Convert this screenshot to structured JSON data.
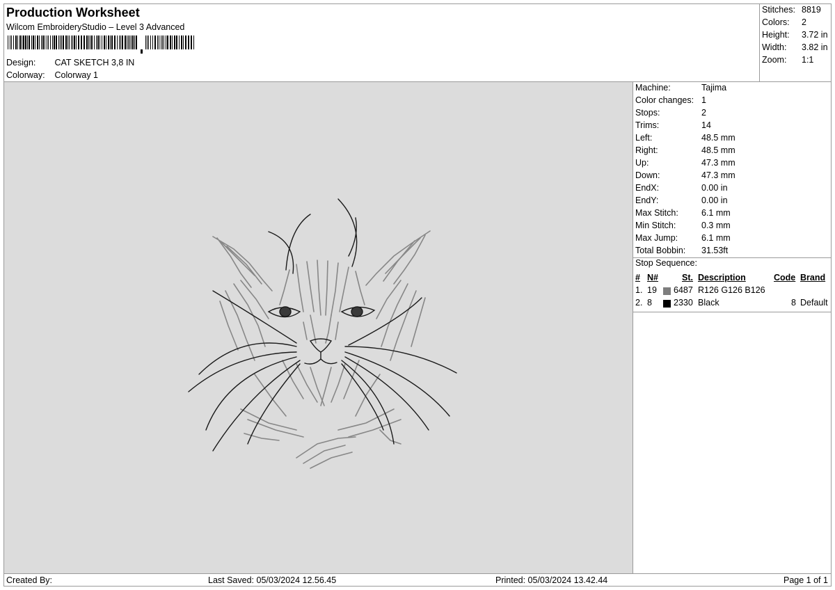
{
  "header": {
    "title": "Production Worksheet",
    "subtitle": "Wilcom EmbroideryStudio – Level 3 Advanced",
    "design_label": "Design:",
    "design_value": "CAT SKETCH 3,8 IN",
    "colorway_label": "Colorway:",
    "colorway_value": "Colorway 1"
  },
  "stats": {
    "stitches_label": "Stitches:",
    "stitches_value": "8819",
    "colors_label": "Colors:",
    "colors_value": "2",
    "height_label": "Height:",
    "height_value": "3.72 in",
    "width_label": "Width:",
    "width_value": "3.82 in",
    "zoom_label": "Zoom:",
    "zoom_value": "1:1"
  },
  "machine": {
    "rows": [
      {
        "label": "Machine:",
        "value": "Tajima"
      },
      {
        "label": "Color changes:",
        "value": "1"
      },
      {
        "label": "Stops:",
        "value": "2"
      },
      {
        "label": "Trims:",
        "value": "14"
      },
      {
        "label": "Left:",
        "value": "48.5 mm"
      },
      {
        "label": "Right:",
        "value": "48.5 mm"
      },
      {
        "label": "Up:",
        "value": "47.3 mm"
      },
      {
        "label": "Down:",
        "value": "47.3 mm"
      },
      {
        "label": "EndX:",
        "value": "0.00 in"
      },
      {
        "label": "EndY:",
        "value": "0.00 in"
      },
      {
        "label": "Max Stitch:",
        "value": "6.1 mm"
      },
      {
        "label": "Min Stitch:",
        "value": "0.3 mm"
      },
      {
        "label": "Max Jump:",
        "value": "6.1 mm"
      },
      {
        "label": "Total Bobbin:",
        "value": "31.53ft"
      }
    ]
  },
  "stop_sequence": {
    "title": "Stop Sequence:",
    "headers": {
      "num": "#",
      "n": "N#",
      "st": "St.",
      "description": "Description",
      "code": "Code",
      "brand": "Brand"
    },
    "rows": [
      {
        "num": "1.",
        "n": "19",
        "color": "#7e7e7e",
        "st": "6487",
        "description": "R126 G126 B126",
        "code": "",
        "brand": ""
      },
      {
        "num": "2.",
        "n": "8",
        "color": "#000000",
        "st": "2330",
        "description": "Black",
        "code": "8",
        "brand": "Default"
      }
    ]
  },
  "footer": {
    "created_by": "Created By:",
    "last_saved": "Last Saved: 05/03/2024 12.56.45",
    "printed": "Printed: 05/03/2024 13.42.44",
    "page": "Page 1 of 1"
  }
}
